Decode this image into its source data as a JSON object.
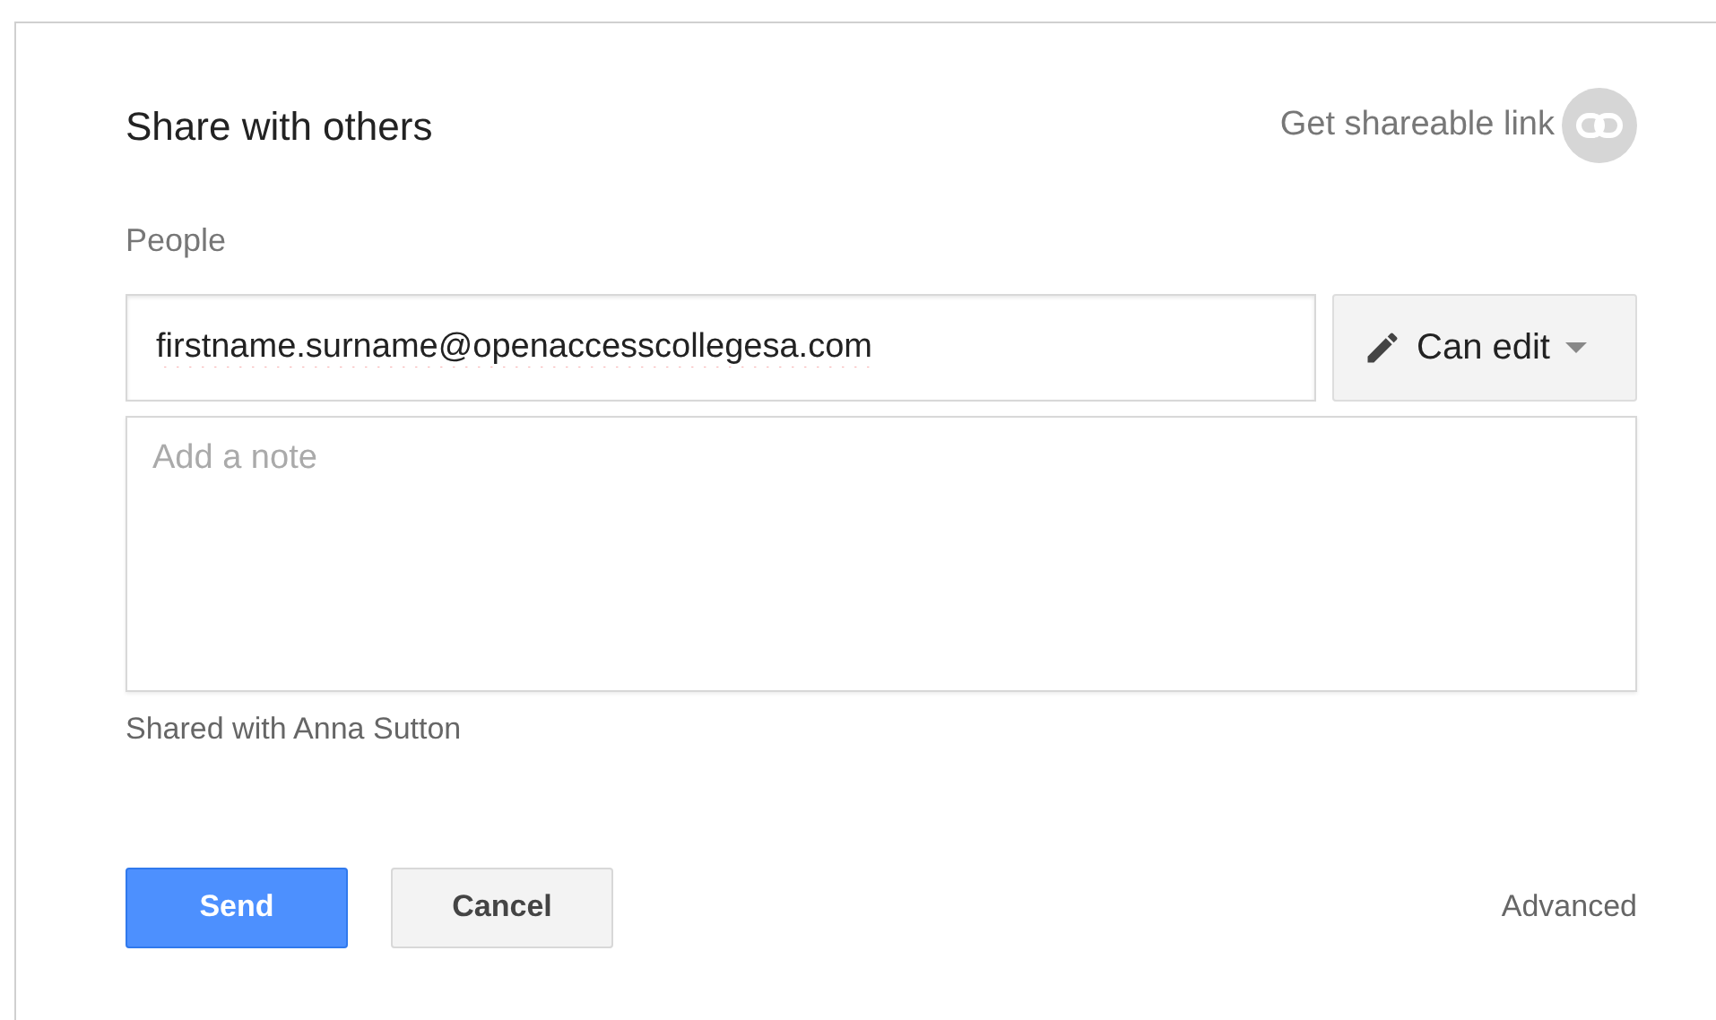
{
  "dialog": {
    "title": "Share with others",
    "link_label": "Get shareable link"
  },
  "people": {
    "label": "People",
    "value": "firstname.surname@openaccesscollegesa.com",
    "permission": "Can edit"
  },
  "note": {
    "placeholder": "Add a note"
  },
  "shared_with": "Shared with Anna Sutton",
  "buttons": [
    {
      "label": "Send",
      "kind": "primary"
    },
    {
      "label": "Cancel",
      "kind": "secondary"
    }
  ],
  "advanced": "Advanced"
}
